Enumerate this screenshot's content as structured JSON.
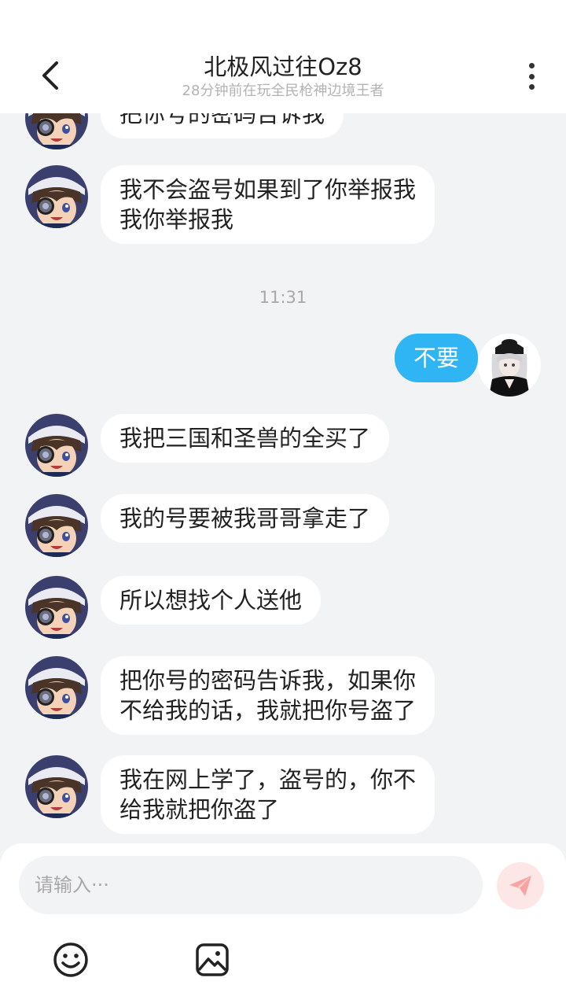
{
  "header": {
    "title": "北极风过往Oz8",
    "subtitle": "28分钟前在玩全民枪神边境王者"
  },
  "messages": [
    {
      "side": "left",
      "lines": [
        "把你号的密码告诉我"
      ]
    },
    {
      "side": "left",
      "lines": [
        "我不会盗号如果到了你举报我",
        "我你举报我"
      ]
    },
    {
      "time": "11:31"
    },
    {
      "side": "right",
      "lines": [
        "不要"
      ]
    },
    {
      "side": "left",
      "lines": [
        "我把三国和圣兽的全买了"
      ]
    },
    {
      "side": "left",
      "lines": [
        "我的号要被我哥哥拿走了"
      ]
    },
    {
      "side": "left",
      "lines": [
        "所以想找个人送他"
      ]
    },
    {
      "side": "left",
      "lines": [
        "把你号的密码告诉我，如果你",
        "不给我的话，我就把你号盗了"
      ]
    },
    {
      "side": "left",
      "lines": [
        "我在网上学了，盗号的，你不",
        "给我就把你盗了"
      ]
    }
  ],
  "input": {
    "placeholder": "请输入···"
  },
  "icons": {
    "back": "chevron-left-icon",
    "more": "more-vertical-icon",
    "send": "paper-plane-icon",
    "emoji": "smiley-icon",
    "image": "image-icon"
  },
  "colors": {
    "outgoing_bubble": "#2fb4f4",
    "incoming_bubble": "#ffffff",
    "background": "#f2f3f5",
    "send_button": "#fde6e6",
    "send_icon": "#f6a3a3"
  }
}
